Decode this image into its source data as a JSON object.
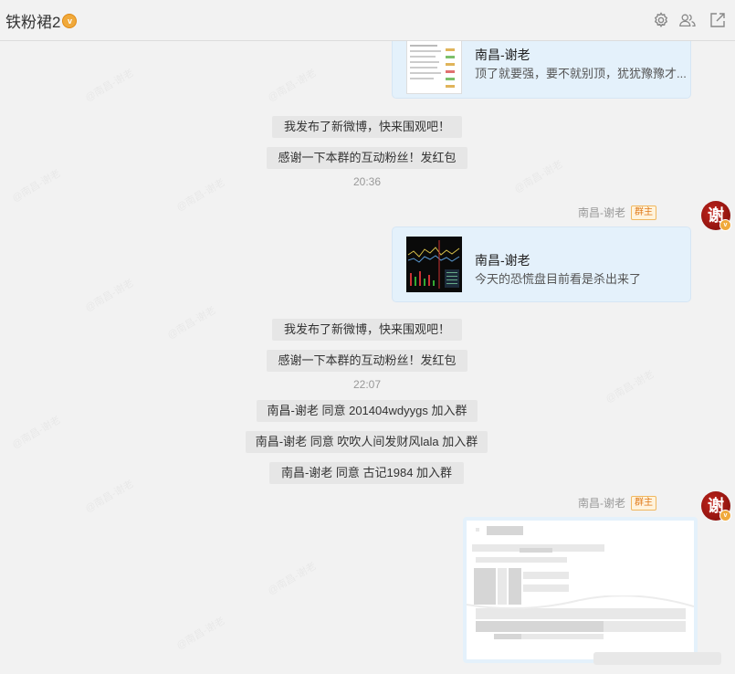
{
  "header": {
    "title": "铁粉裙2",
    "icons": [
      "settings-icon",
      "members-icon",
      "popout-icon"
    ]
  },
  "messages": {
    "card1": {
      "title": "南昌-谢老",
      "desc": "顶了就要强，要不就别顶，犹犹豫豫才..."
    },
    "sys1": "我发布了新微博，快来围观吧！",
    "sys2": "感谢一下本群的互动粉丝！发红包",
    "time1": "20:36",
    "sender1": {
      "name": "南昌-谢老",
      "role": "群主",
      "avatar_char": "谢"
    },
    "card2": {
      "title": "南昌-谢老",
      "desc": "今天的恐慌盘目前看是杀出来了"
    },
    "sys3": "我发布了新微博，快来围观吧！",
    "sys4": "感谢一下本群的互动粉丝！发红包",
    "time2": "22:07",
    "join1": "南昌-谢老 同意 201404wdyygs 加入群",
    "join2": "南昌-谢老 同意 吹吹人间发财风lala 加入群",
    "join3": "南昌-谢老 同意 古记1984 加入群",
    "sender2": {
      "name": "南昌-谢老",
      "role": "群主",
      "avatar_char": "谢"
    }
  },
  "colors": {
    "card_bg": "#e4f1fb",
    "role_badge": "#e07a1a",
    "avatar": "#a5150f"
  }
}
